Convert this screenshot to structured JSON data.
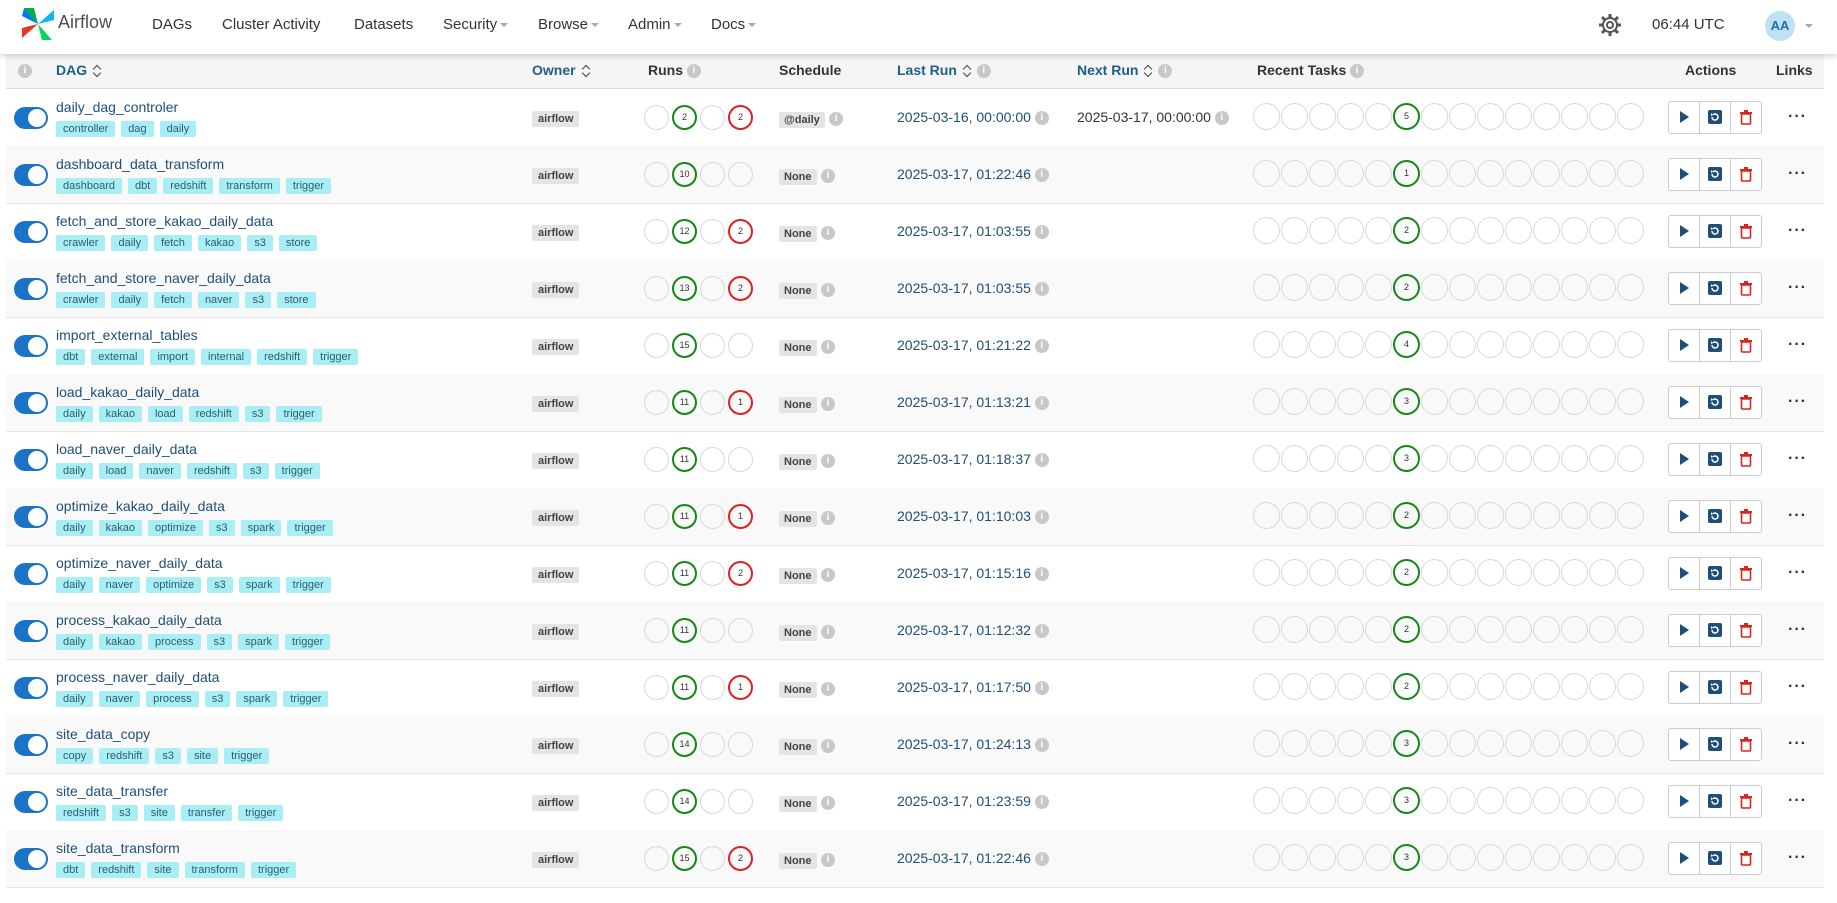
{
  "app": {
    "brand": "Airflow"
  },
  "nav": {
    "items": [
      {
        "label": "DAGs",
        "caret": false
      },
      {
        "label": "Cluster Activity",
        "caret": false
      },
      {
        "label": "Datasets",
        "caret": false
      },
      {
        "label": "Security",
        "caret": true
      },
      {
        "label": "Browse",
        "caret": true
      },
      {
        "label": "Admin",
        "caret": true
      },
      {
        "label": "Docs",
        "caret": true
      }
    ],
    "time": "06:44 UTC",
    "user_initials": "AA"
  },
  "table": {
    "headers": {
      "info": "i",
      "dag": "DAG",
      "owner": "Owner",
      "runs": "Runs",
      "schedule": "Schedule",
      "last_run": "Last Run",
      "next_run": "Next Run",
      "recent_tasks": "Recent Tasks",
      "actions": "Actions",
      "links": "Links"
    },
    "rows": [
      {
        "name": "daily_dag_controler",
        "tags": [
          "controller",
          "dag",
          "daily"
        ],
        "owner": "airflow",
        "runs": [
          "",
          "2",
          "",
          "2"
        ],
        "schedule": "@daily",
        "last_run": "2025-03-16, 00:00:00",
        "next_run": "2025-03-17, 00:00:00",
        "task_count": "5"
      },
      {
        "name": "dashboard_data_transform",
        "tags": [
          "dashboard",
          "dbt",
          "redshift",
          "transform",
          "trigger"
        ],
        "owner": "airflow",
        "runs": [
          "",
          "10",
          "",
          ""
        ],
        "schedule": "None",
        "last_run": "2025-03-17, 01:22:46",
        "next_run": "",
        "task_count": "1"
      },
      {
        "name": "fetch_and_store_kakao_daily_data",
        "tags": [
          "crawler",
          "daily",
          "fetch",
          "kakao",
          "s3",
          "store"
        ],
        "owner": "airflow",
        "runs": [
          "",
          "12",
          "",
          "2"
        ],
        "schedule": "None",
        "last_run": "2025-03-17, 01:03:55",
        "next_run": "",
        "task_count": "2"
      },
      {
        "name": "fetch_and_store_naver_daily_data",
        "tags": [
          "crawler",
          "daily",
          "fetch",
          "naver",
          "s3",
          "store"
        ],
        "owner": "airflow",
        "runs": [
          "",
          "13",
          "",
          "2"
        ],
        "schedule": "None",
        "last_run": "2025-03-17, 01:03:55",
        "next_run": "",
        "task_count": "2"
      },
      {
        "name": "import_external_tables",
        "tags": [
          "dbt",
          "external",
          "import",
          "internal",
          "redshift",
          "trigger"
        ],
        "owner": "airflow",
        "runs": [
          "",
          "15",
          "",
          ""
        ],
        "schedule": "None",
        "last_run": "2025-03-17, 01:21:22",
        "next_run": "",
        "task_count": "4"
      },
      {
        "name": "load_kakao_daily_data",
        "tags": [
          "daily",
          "kakao",
          "load",
          "redshift",
          "s3",
          "trigger"
        ],
        "owner": "airflow",
        "runs": [
          "",
          "11",
          "",
          "1"
        ],
        "schedule": "None",
        "last_run": "2025-03-17, 01:13:21",
        "next_run": "",
        "task_count": "3"
      },
      {
        "name": "load_naver_daily_data",
        "tags": [
          "daily",
          "load",
          "naver",
          "redshift",
          "s3",
          "trigger"
        ],
        "owner": "airflow",
        "runs": [
          "",
          "11",
          "",
          ""
        ],
        "schedule": "None",
        "last_run": "2025-03-17, 01:18:37",
        "next_run": "",
        "task_count": "3"
      },
      {
        "name": "optimize_kakao_daily_data",
        "tags": [
          "daily",
          "kakao",
          "optimize",
          "s3",
          "spark",
          "trigger"
        ],
        "owner": "airflow",
        "runs": [
          "",
          "11",
          "",
          "1"
        ],
        "schedule": "None",
        "last_run": "2025-03-17, 01:10:03",
        "next_run": "",
        "task_count": "2"
      },
      {
        "name": "optimize_naver_daily_data",
        "tags": [
          "daily",
          "naver",
          "optimize",
          "s3",
          "spark",
          "trigger"
        ],
        "owner": "airflow",
        "runs": [
          "",
          "11",
          "",
          "2"
        ],
        "schedule": "None",
        "last_run": "2025-03-17, 01:15:16",
        "next_run": "",
        "task_count": "2"
      },
      {
        "name": "process_kakao_daily_data",
        "tags": [
          "daily",
          "kakao",
          "process",
          "s3",
          "spark",
          "trigger"
        ],
        "owner": "airflow",
        "runs": [
          "",
          "11",
          "",
          ""
        ],
        "schedule": "None",
        "last_run": "2025-03-17, 01:12:32",
        "next_run": "",
        "task_count": "2"
      },
      {
        "name": "process_naver_daily_data",
        "tags": [
          "daily",
          "naver",
          "process",
          "s3",
          "spark",
          "trigger"
        ],
        "owner": "airflow",
        "runs": [
          "",
          "11",
          "",
          "1"
        ],
        "schedule": "None",
        "last_run": "2025-03-17, 01:17:50",
        "next_run": "",
        "task_count": "2"
      },
      {
        "name": "site_data_copy",
        "tags": [
          "copy",
          "redshift",
          "s3",
          "site",
          "trigger"
        ],
        "owner": "airflow",
        "runs": [
          "",
          "14",
          "",
          ""
        ],
        "schedule": "None",
        "last_run": "2025-03-17, 01:24:13",
        "next_run": "",
        "task_count": "3"
      },
      {
        "name": "site_data_transfer",
        "tags": [
          "redshift",
          "s3",
          "site",
          "transfer",
          "trigger"
        ],
        "owner": "airflow",
        "runs": [
          "",
          "14",
          "",
          ""
        ],
        "schedule": "None",
        "last_run": "2025-03-17, 01:23:59",
        "next_run": "",
        "task_count": "3"
      },
      {
        "name": "site_data_transform",
        "tags": [
          "dbt",
          "redshift",
          "site",
          "transform",
          "trigger"
        ],
        "owner": "airflow",
        "runs": [
          "",
          "15",
          "",
          "2"
        ],
        "schedule": "None",
        "last_run": "2025-03-17, 01:22:46",
        "next_run": "",
        "task_count": "3"
      }
    ]
  },
  "colors": {
    "success": "#138813",
    "failed": "#e02020",
    "toggle_on": "#1a73c7",
    "tag_bg": "#a9eef4"
  },
  "icons": {
    "trigger": "play-icon",
    "refresh": "refresh-icon",
    "delete": "trash-icon",
    "links": "ellipsis-icon",
    "settings": "gear-icon"
  }
}
